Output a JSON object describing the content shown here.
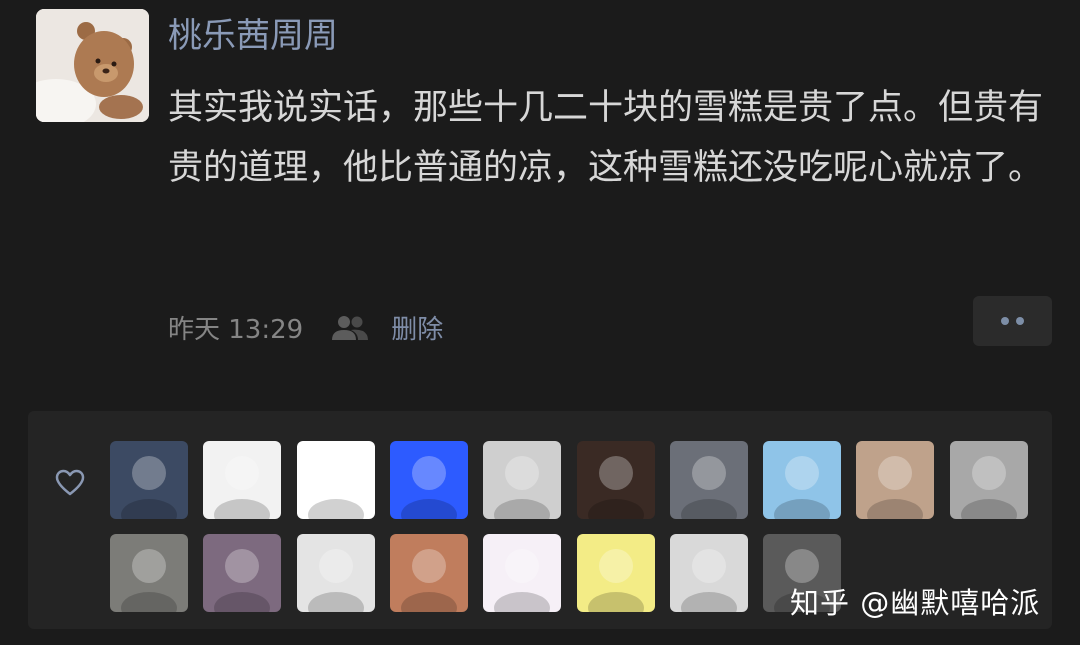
{
  "post": {
    "username": "桃乐茜周周",
    "content": "其实我说实话，那些十几二十块的雪糕是贵了点。但贵有贵的道理，他比普通的凉，这种雪糕还没吃呢心就凉了。",
    "timestamp": "昨天 13:29",
    "delete_label": "删除",
    "visibility_icon": "friends-icon",
    "more_icon": "more-icon"
  },
  "likes": {
    "icon": "heart-icon",
    "row1": [
      {
        "name": "liker-1",
        "accent": "#3c4a63"
      },
      {
        "name": "liker-2",
        "accent": "#f2f2f2"
      },
      {
        "name": "liker-3",
        "accent": "#ffffff"
      },
      {
        "name": "liker-4",
        "accent": "#2d5bff"
      },
      {
        "name": "liker-5",
        "accent": "#cfcfcf"
      },
      {
        "name": "liker-6",
        "accent": "#3a2a24"
      },
      {
        "name": "liker-7",
        "accent": "#6b6f78"
      },
      {
        "name": "liker-8",
        "accent": "#8fc4e8"
      },
      {
        "name": "liker-9",
        "accent": "#bfa28b"
      },
      {
        "name": "liker-10",
        "accent": "#a8a8a8"
      }
    ],
    "row2": [
      {
        "name": "liker-11",
        "accent": "#7c7c78"
      },
      {
        "name": "liker-12",
        "accent": "#7d6a7f"
      },
      {
        "name": "liker-13",
        "accent": "#e4e4e4"
      },
      {
        "name": "liker-14",
        "accent": "#c07d5d"
      },
      {
        "name": "liker-15",
        "accent": "#f6f0f7"
      },
      {
        "name": "liker-16",
        "accent": "#f3ec86"
      },
      {
        "name": "liker-17",
        "accent": "#d9d9d9"
      },
      {
        "name": "liker-18",
        "accent": "#5a5a5a"
      }
    ]
  },
  "watermark": "知乎 @幽默嘻哈派"
}
